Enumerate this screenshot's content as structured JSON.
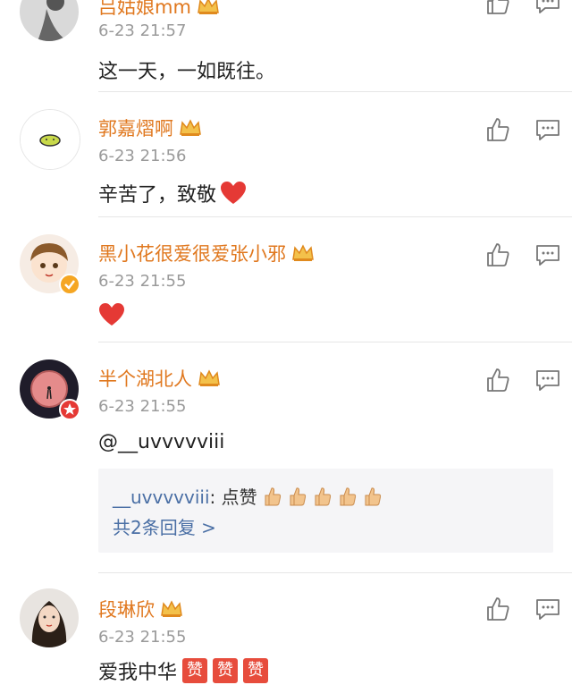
{
  "comments": [
    {
      "name": "吕姑娘mm",
      "time": "6-23 21:57",
      "content": "这一天，一如既往。"
    },
    {
      "name": "郭嘉熠啊",
      "time": "6-23 21:56",
      "content": "辛苦了，致敬"
    },
    {
      "name": "黑小花很爱很爱张小邪",
      "time": "6-23 21:55",
      "content": ""
    },
    {
      "name": "半个湖北人",
      "time": "6-23 21:55",
      "content": "@__uvvvvviii",
      "reply": {
        "user": "__uvvvvviii",
        "text": ": 点赞",
        "more": "共2条回复 >"
      }
    },
    {
      "name": "段琳欣",
      "time": "6-23 21:55",
      "content": "爱我中华",
      "zan": "赞"
    }
  ],
  "colors": {
    "name": "#e0781f",
    "link": "#4a6fa5",
    "heart": "#e53935"
  }
}
